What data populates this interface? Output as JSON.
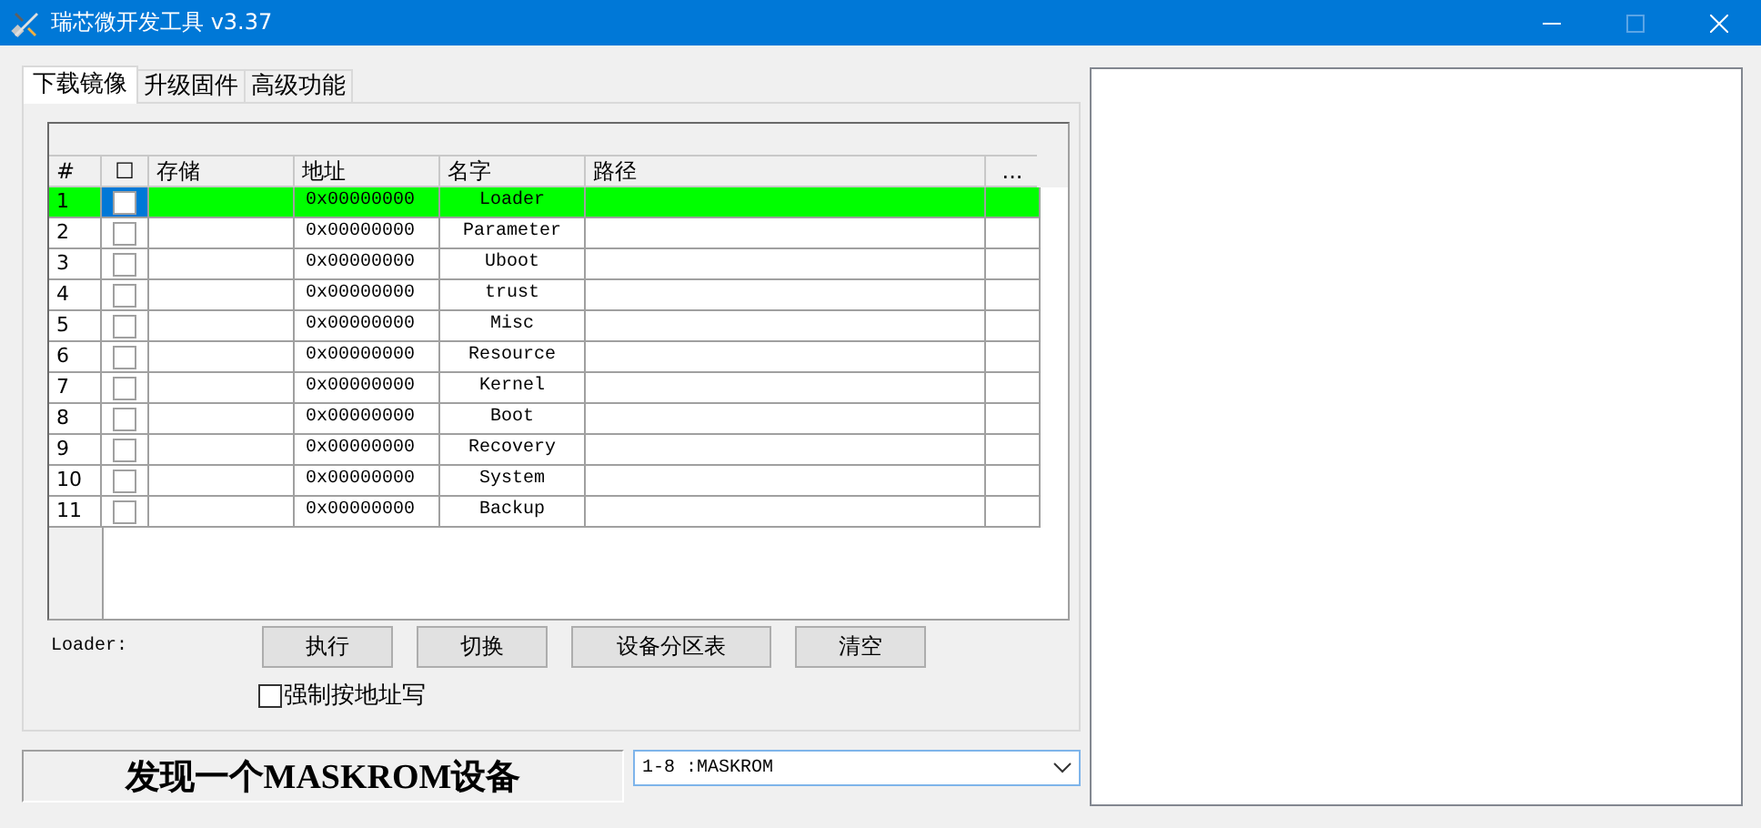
{
  "window": {
    "title": "瑞芯微开发工具 v3.37"
  },
  "tabs": [
    {
      "label": "下载镜像",
      "selected": true
    },
    {
      "label": "升级固件",
      "selected": false
    },
    {
      "label": "高级功能",
      "selected": false
    }
  ],
  "table": {
    "columns": [
      "#",
      "☐",
      "存储",
      "地址",
      "名字",
      "路径",
      "..."
    ],
    "rows": [
      {
        "index": "1",
        "checked": false,
        "selected": true,
        "address": "0x00000000",
        "name": "Loader"
      },
      {
        "index": "2",
        "checked": false,
        "selected": false,
        "address": "0x00000000",
        "name": "Parameter"
      },
      {
        "index": "3",
        "checked": false,
        "selected": false,
        "address": "0x00000000",
        "name": "Uboot"
      },
      {
        "index": "4",
        "checked": false,
        "selected": false,
        "address": "0x00000000",
        "name": "trust"
      },
      {
        "index": "5",
        "checked": false,
        "selected": false,
        "address": "0x00000000",
        "name": "Misc"
      },
      {
        "index": "6",
        "checked": false,
        "selected": false,
        "address": "0x00000000",
        "name": "Resource"
      },
      {
        "index": "7",
        "checked": false,
        "selected": false,
        "address": "0x00000000",
        "name": "Kernel"
      },
      {
        "index": "8",
        "checked": false,
        "selected": false,
        "address": "0x00000000",
        "name": "Boot"
      },
      {
        "index": "9",
        "checked": false,
        "selected": false,
        "address": "0x00000000",
        "name": "Recovery"
      },
      {
        "index": "10",
        "checked": false,
        "selected": false,
        "address": "0x00000000",
        "name": "System"
      },
      {
        "index": "11",
        "checked": false,
        "selected": false,
        "address": "0x00000000",
        "name": "Backup"
      }
    ]
  },
  "loader_label": "Loader:",
  "buttons": [
    "执行",
    "切换",
    "设备分区表",
    "清空"
  ],
  "force_address_write": {
    "label": "强制按地址写",
    "checked": false
  },
  "status": "发现一个MASKROM设备",
  "device_select": {
    "value": "1-8 :MASKROM"
  }
}
